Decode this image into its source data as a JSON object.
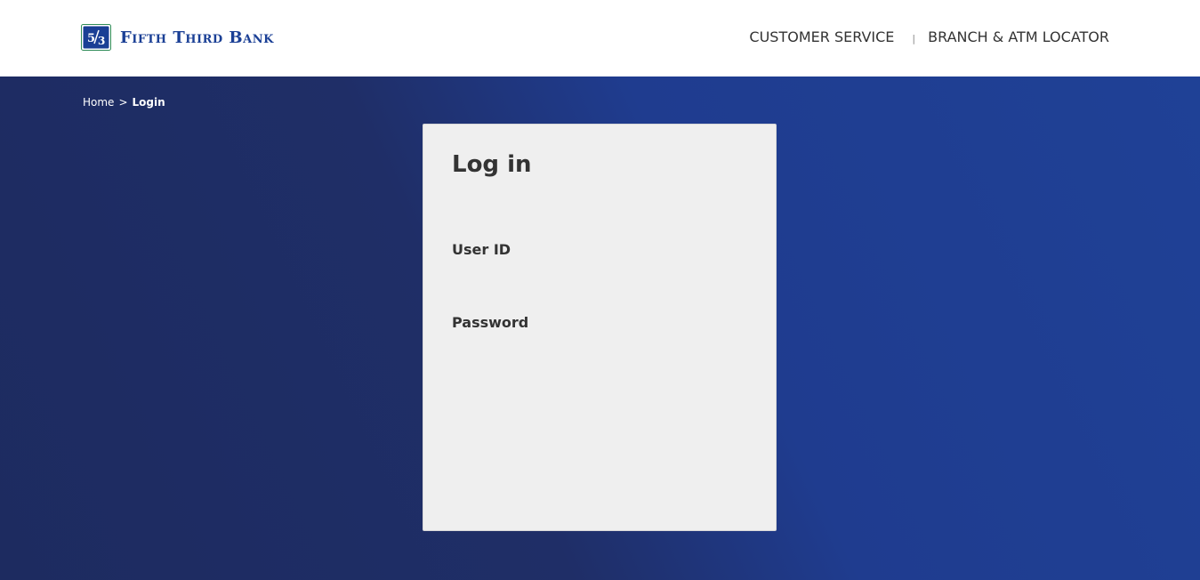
{
  "header": {
    "logo_text": "Fifth Third Bank",
    "nav": [
      {
        "label": "CUSTOMER SERVICE"
      },
      {
        "label": "BRANCH & ATM LOCATOR"
      }
    ],
    "separator": "|"
  },
  "breadcrumb": {
    "home": "Home",
    "chevron": ">",
    "current": "Login"
  },
  "login": {
    "title": "Log in",
    "user_id_label": "User ID",
    "password_label": "Password"
  },
  "colors": {
    "brand_blue": "#1a3f95",
    "hero_dark": "#1d2b60",
    "hero_light": "#1f4196",
    "card_bg": "#efefef"
  },
  "icons": {
    "logo": "fifth-third-logo-icon"
  }
}
